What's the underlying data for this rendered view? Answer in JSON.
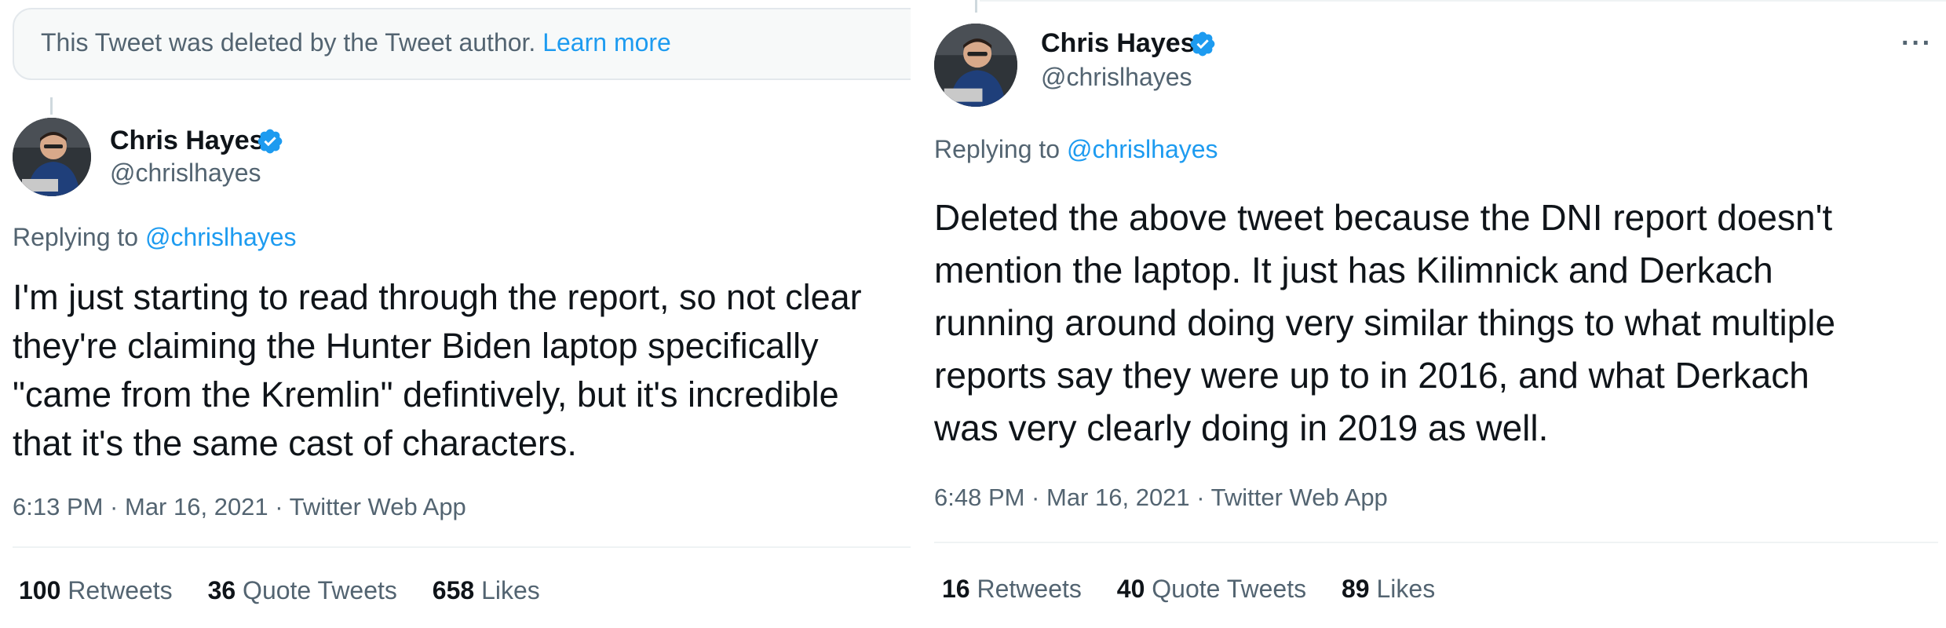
{
  "left": {
    "deleted_notice": {
      "text": "This Tweet was deleted by the Tweet author.",
      "link": "Learn more"
    },
    "author": {
      "name": "Chris Hayes",
      "handle": "@chrislhayes"
    },
    "replying": {
      "prefix": "Replying to",
      "mention": "@chrislhayes"
    },
    "text_lines": [
      "I'm just starting to read through the report, so not clear",
      "they're claiming the Hunter Biden laptop specifically",
      "\"came from the Kremlin\" defintively, but it's incredible",
      "that it's the same cast of characters."
    ],
    "meta": "6:13 PM · Mar 16, 2021 · Twitter Web App",
    "stats": {
      "retweets": {
        "count": "100",
        "label": "Retweets"
      },
      "quotes": {
        "count": "36",
        "label": "Quote Tweets"
      },
      "likes": {
        "count": "658",
        "label": "Likes"
      }
    }
  },
  "right": {
    "author": {
      "name": "Chris Hayes",
      "handle": "@chrislhayes"
    },
    "more": "···",
    "replying": {
      "prefix": "Replying to",
      "mention": "@chrislhayes"
    },
    "text_lines": [
      "Deleted the above tweet because the DNI report doesn't",
      "mention the laptop. It just has Kilimnick and Derkach",
      "running around doing very similar things to what multiple",
      "reports say they were up to in 2016, and what Derkach",
      "was very clearly doing in 2019 as well."
    ],
    "meta": "6:48 PM · Mar 16, 2021 · Twitter Web App",
    "stats": {
      "retweets": {
        "count": "16",
        "label": "Retweets"
      },
      "quotes": {
        "count": "40",
        "label": "Quote Tweets"
      },
      "likes": {
        "count": "89",
        "label": "Likes"
      }
    }
  },
  "colors": {
    "link": "#1d9bf0",
    "secondary_text": "#536471",
    "primary_text": "#0f1419",
    "divider": "#eff3f4"
  },
  "icons": {
    "verified": "verified-badge-icon",
    "more": "more-icon"
  }
}
